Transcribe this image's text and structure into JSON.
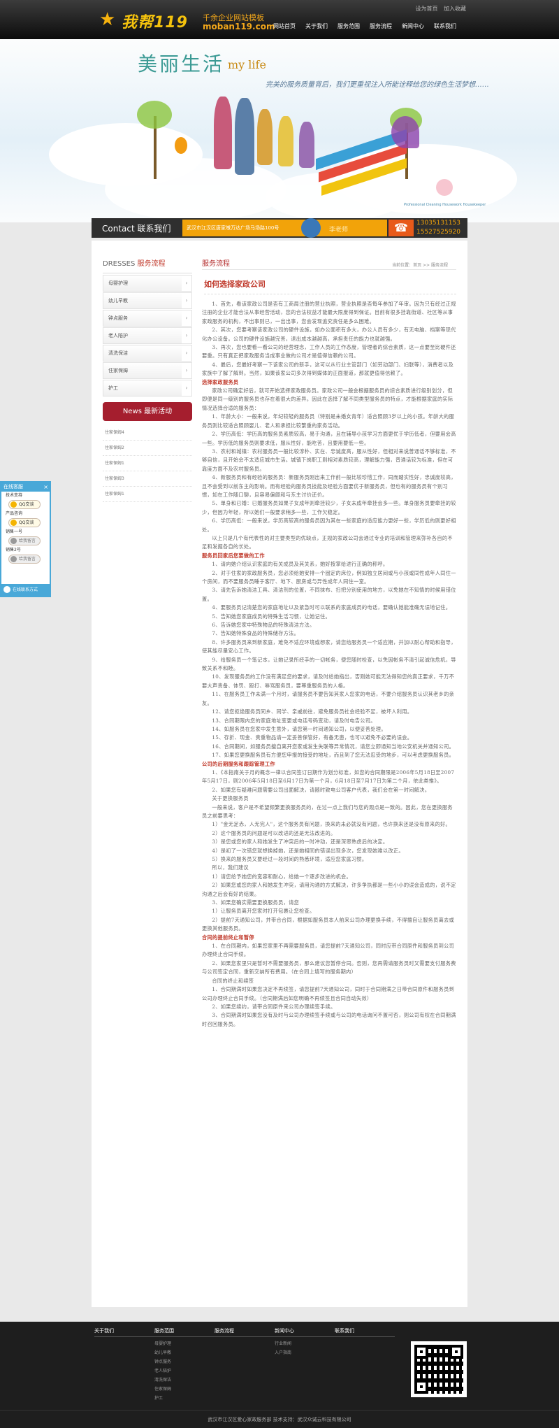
{
  "header": {
    "logo_text": "我帮119",
    "logo_tagline": "千余企业网站模板",
    "logo_domain": "moban119.com",
    "top_links": [
      "设为首页",
      "加入收藏"
    ],
    "nav": [
      "网站首页",
      "关于我们",
      "服务范围",
      "服务流程",
      "新闻中心",
      "联系我们"
    ]
  },
  "banner": {
    "title": "美丽生活",
    "title_en": "my life",
    "slogan": "完美的服务质量背后，我们更重视注入所能诠释给您的绿色生活梦想……",
    "caption_en": "Professional Cleaning  Housework Housekeeper"
  },
  "contact": {
    "label": "Contact 联系我们",
    "address": "武汉市江汉区唐家墩万达广场马场路100号",
    "person": "李老师",
    "phones": [
      "13035131153",
      "15527525920"
    ]
  },
  "sidebar": {
    "title_en": "DRESSES",
    "title_cn": "服务流程",
    "items": [
      "母婴护理",
      "幼儿早教",
      "钟点服务",
      "老人陪护",
      "清洗保洁",
      "住家保姆",
      "护工"
    ],
    "news_title": "News 最新活动",
    "news": [
      "住家保姆4",
      "住家保姆2",
      "住家保姆1",
      "住家保姆3",
      "住家保姆1"
    ]
  },
  "main": {
    "title": "服务流程",
    "breadcrumb": "当前位置：首页 >> 服务流程",
    "article_title": "如何选择家政公司",
    "paragraphs": [
      {
        "type": "p",
        "text": "1、首先，看该家政公司是否有工商局注册的营业执照，营业执照是否每年参加了年审。因为只有经过正规注册的企业才能合法从事经营活动，您的合法权益才能最大限度得到保证。目前有很多挂靠街道、社区等从事家政服务的机构，不出事则已，一出出事，您会发现追究责任是多么困难。"
      },
      {
        "type": "p",
        "text": "2、其次，您要考察该家政公司的硬件设施，如办公面积有多大，办公人员有多少，有无电脑、档案等现代化办公设备。公司的硬件设施越完善，退出成本越越高，承担责任的能力也就越强。"
      },
      {
        "type": "p",
        "text": "3、再次，您也要看一看公司的经营理念，工作人员的工作态度，管理者的综合素质，这一点要至比硬件还要重。只有真正把家政服务当成事业做的公司才是值得信赖的公司。"
      },
      {
        "type": "p",
        "text": "4、最后，您最好考察一下该家公司的新手，这可以从行业主管部门（如劳动部门、妇联等），消费者以及家族中了解了解到。当然，如果该家公司多次得到媒体的正面报道，那就更值得信赖了。"
      },
      {
        "type": "h",
        "text": "选择家政服务员"
      },
      {
        "type": "p",
        "text": "家政公司确定好后，就可开始选择家政服务员。家政公司一般会根据服务员的综合素质进行级别划分，但即便是同一级别的服务员也存在着很大的差异。因此在选择了解不同类型服务员的特点，才能根据家庭的实际情况选择合适的服务员："
      },
      {
        "type": "p",
        "text": "1、年龄大小：一般来说，年纪较轻的服务员（特别是未婚女青年）适合照顾3岁以上的小孩。年龄大的服务员则比较适合照顾婴儿、老人和承担比较繁重的家务活动。"
      },
      {
        "type": "p",
        "text": "2、学历高低：学历高的服务员素质较高，易于沟通，且在辅导小孩学习方面更优于学历低者，但要用会高一些。学历低的服务员则要求低，服从性好，能吃苦，且要用要低一些。"
      },
      {
        "type": "p",
        "text": "3、农村和城镇：农村服务员一般比较淳朴、实在、忠诚度高，服从性好，但相对来说普通话不够标准，不够自信，且开始会不太适应城市生活。城镇下岗职工则相对素质较高，理解能力强，普通话较为标准，但在可靠度方面不及农村服务员。"
      },
      {
        "type": "p",
        "text": "4、新服务员和有经验的服务员：新服务员刚出来工作前一般比较珍惜工作，同而踏实性好，忠诚度较高，且不会受到以前东主的影响。而有经验的服务员技能及经验方面要优于新服务员，但也有的服务员有个别习惯，如在工作随口聊，且容易偏颇和与东主讨价还价。"
      },
      {
        "type": "p",
        "text": "5、单身和已婚：已婚服务员如果子女成年则牵挂较少，子女未成年牵挂会多一些。单身服务员要牵挂的较少，但因为年轻，所以她们一般要求稍多一些，工作欠稳定。"
      },
      {
        "type": "p",
        "text": "6、学历高低：一般来说，学历高较高的服务员因为其在一些家庭的适应能力更好一些，学历低的则更好相处。"
      },
      {
        "type": "p",
        "text": "以上只是几个有代表性的对主要类型的优缺点，正规的家政公司会通过专业的培训和管理来弥补各自的不足和发掘各自的长处。"
      },
      {
        "type": "h",
        "text": "服务员回家后您要做的工作"
      },
      {
        "type": "p",
        "text": "1、请向她介绍认识家庭的有关成员及其关系，她好按掌给进行正确的称呼。"
      },
      {
        "type": "p",
        "text": "2、对于住家的家政服务员，您必须给她安排一个固定的床位，例如独立居间或与小孩或同性成年人同住一个房间，而不要服务员睡于客厅、地下、厨房或与异性成年人同住一室。"
      },
      {
        "type": "p",
        "text": "3、请先告诉她清洁工具、清洁剂的位置，不同抹布、扫把分别使用的地方，以免她在不知情的时候用错位置。"
      },
      {
        "type": "p",
        "text": "4、要服务员记清楚您的家庭地址以及紧急时可以联系的家庭成员的电话，要确认她能准确无误地记住。"
      },
      {
        "type": "p",
        "text": "5、告知她您家庭成员的特殊生活习惯，让她记住。"
      },
      {
        "type": "p",
        "text": "6、告诉她您家中特殊物品的特殊清洁方法。"
      },
      {
        "type": "p",
        "text": "7、告知她特殊食品的特殊储存方法。"
      },
      {
        "type": "p",
        "text": "8、许多服务员来到新家庭，难免不适应环境或想家，请您给服务员一个适应期，并加以耐心帮助和指导，使其能尽量安心工作。"
      },
      {
        "type": "p",
        "text": "9、给服务员一个笔记本，让她记录所经手的一切帐务，便您随时检查，以免因帐务不清引起诚信危机，导致关系不和睦。"
      },
      {
        "type": "p",
        "text": "10、发现服务员的工作没有满足您的要求，请及时给她指出，否则她可能无法得知您的真正要求，千万不要大声责备、体罚、殴打、辱骂服务员，要尊重服务员的人格。"
      },
      {
        "type": "p",
        "text": "11、在服务员工作未满一个月时，请服务员不要告知其家人您家的电话，不要介绍服务员认识其老乡的亲友。"
      },
      {
        "type": "p",
        "text": "12、请您拒绝服务员同乡、同学、亲戚前往，避免服务员社会经验不足，被坏人利用。"
      },
      {
        "type": "p",
        "text": "13、合同期限内您的家庭地址变更或电话号码变动，请及时电告公司。"
      },
      {
        "type": "p",
        "text": "14、如服务员在您家中发生意外，请您第一时间通知公司，以便妥善处理。"
      },
      {
        "type": "p",
        "text": "15、存折、现金、贵重物品请一定妥善保管好，有备无患，也可以避免不必要的误会。"
      },
      {
        "type": "p",
        "text": "16、合同期间，如服务员擅自离开您家或发生失联等异常情况，请您立即通知当地公安机关并通知公司。"
      },
      {
        "type": "p",
        "text": "17、如果您更换服务员有方便您申报的接受的地址，而且到了您无法忍受的地步，可以考虑更换服务员。"
      },
      {
        "type": "h",
        "text": "公司的后期服务和跟踪管理工作"
      },
      {
        "type": "p",
        "text": "1、《本指南关于月的概念一律以合同签订日期作为划分标准，如您的合同期限是2006年5月18日至2007年5月17日，则2006年5月18日至6月17日为第一个月，6月18日至7月17日为第二个月，依此类推》。"
      },
      {
        "type": "p",
        "text": "2、如果您有疑难问题需要公司出面解决，请随时致电公司客户代表，我们会在第一时间解决。"
      },
      {
        "type": "p",
        "text": "关于更换服务员"
      },
      {
        "type": "p",
        "text": "一般来说，客户是不希望频繁更换服务员的，在过一点上我们与您的观点是一致的。因此，您在更换服务员之前要思考："
      },
      {
        "type": "p",
        "text": "1）\"金无足赤，人无完人\"，这个服务员有问题，换来的未必就没有问题，也许换来还是没有原来的好。"
      },
      {
        "type": "p",
        "text": "2）这个服务员的问题是可以改进的还是无法改进的。"
      },
      {
        "type": "p",
        "text": "3）是您或您的家人和她发生了冲突后的一时冲动，还是深思熟虑后的决定。"
      },
      {
        "type": "p",
        "text": "4）是初了一次错您就想换掉她，还是她相同的错误出现多次，您发现她难以改正。"
      },
      {
        "type": "p",
        "text": "5）换来的服务员又要经过一段时间的熟悉环境，适应您家庭习惯。"
      },
      {
        "type": "p",
        "text": "所以，我们建议"
      },
      {
        "type": "p",
        "text": "1）请您给予她您的宽容和耐心，给她一个逐步改进的机会。"
      },
      {
        "type": "p",
        "text": "2）如果您或您的家人和她发生冲突，请用沟通的方式解决，许多争执都是一些小小的误会造成的，说不定沟通之后会有好的结果。"
      },
      {
        "type": "p",
        "text": "3、如果您确实需要更换服务员，请您"
      },
      {
        "type": "p",
        "text": "1）让服务员离开您家时打开包裹让您检查。"
      },
      {
        "type": "p",
        "text": "2）提前7天通知公司，并带合合同，根据如服务员本人前来公司办理更换手续，不得擅自让服务员离去或更换其他服务员。"
      },
      {
        "type": "h",
        "text": "合同的提前终止和暂停"
      },
      {
        "type": "p",
        "text": "1、在合同期内，如果您家里不再需要服务员，请您提前7天通知公司，同时应带合同原件和服务员到公司办理终止合同手续。"
      },
      {
        "type": "p",
        "text": "2、如果您家里只是暂时不需要服务员，那么建议您暂停合同。否则，您再需请服务员时又需要支付服务费与公司签定合同，重新交纳所有费用。（在合同上填写的服务期内）"
      },
      {
        "type": "p",
        "text": "合同的终止和续签"
      },
      {
        "type": "p",
        "text": "1、合同期满时如果您决定不再续签，请您提前7天通知公司，同时于合同期满之日带合同原件和服务员到公司办理终止合同手续。（合同期满后如您明确不再续签且合同自动失效）"
      },
      {
        "type": "p",
        "text": "2、如果您续约，请带合同原件来公司办理续签手续。"
      },
      {
        "type": "p",
        "text": "3、合同期满时如果您没有及时与公司办理续签手续或与公司的电话询问不置可否，则公司有权在合同期满时召回服务员。"
      }
    ]
  },
  "float_widget": {
    "title": "在线客服",
    "sections": [
      {
        "label": "技术支持",
        "button": "QQ交谈",
        "active": true
      },
      {
        "label": "产品咨询",
        "button": "QQ交谈",
        "active": true
      },
      {
        "label": "销售一号",
        "button": "给我留言",
        "active": false
      },
      {
        "label": "销售2号",
        "button": "给我留言",
        "active": false
      }
    ],
    "footer": "在线联系方式"
  },
  "footer": {
    "columns": [
      {
        "title": "关于我们",
        "items": []
      },
      {
        "title": "服务范围",
        "items": [
          "母婴护理",
          "幼儿早教",
          "钟点服务",
          "老人陪护",
          "清洗保洁",
          "住家保姆",
          "护工"
        ]
      },
      {
        "title": "服务流程",
        "items": []
      },
      {
        "title": "新闻中心",
        "items": [
          "行业新闻",
          "入户指南"
        ]
      },
      {
        "title": "联系我们",
        "items": []
      }
    ],
    "copyright": "武汉市江汉区爱心家政服务部    技术支持：武汉众诚云科技有限公司"
  },
  "colors": {
    "accent": "#a51e2e",
    "link_red": "#c0392b",
    "header_bg": "#1a1a1a",
    "contact_orange": "#f2a30a"
  }
}
